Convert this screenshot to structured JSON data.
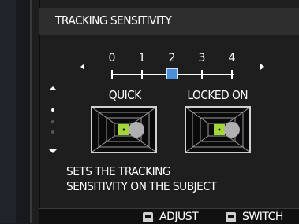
{
  "title": "TRACKING SENSITIVITY",
  "scale": {
    "labels": [
      "0",
      "1",
      "2",
      "3",
      "4"
    ],
    "selected_index": 2
  },
  "modes": {
    "left_label": "QUICK",
    "right_label": "LOCKED ON"
  },
  "description": {
    "line1": "SETS THE TRACKING",
    "line2": "SENSITIVITY ON THE SUBJECT"
  },
  "footer": {
    "adjust_label": "ADJUST",
    "switch_label": "SWITCH"
  },
  "colors": {
    "accent": "#4a8fd8",
    "subject_green": "#a3d63a",
    "obstacle_gray": "#b0b0b0"
  }
}
